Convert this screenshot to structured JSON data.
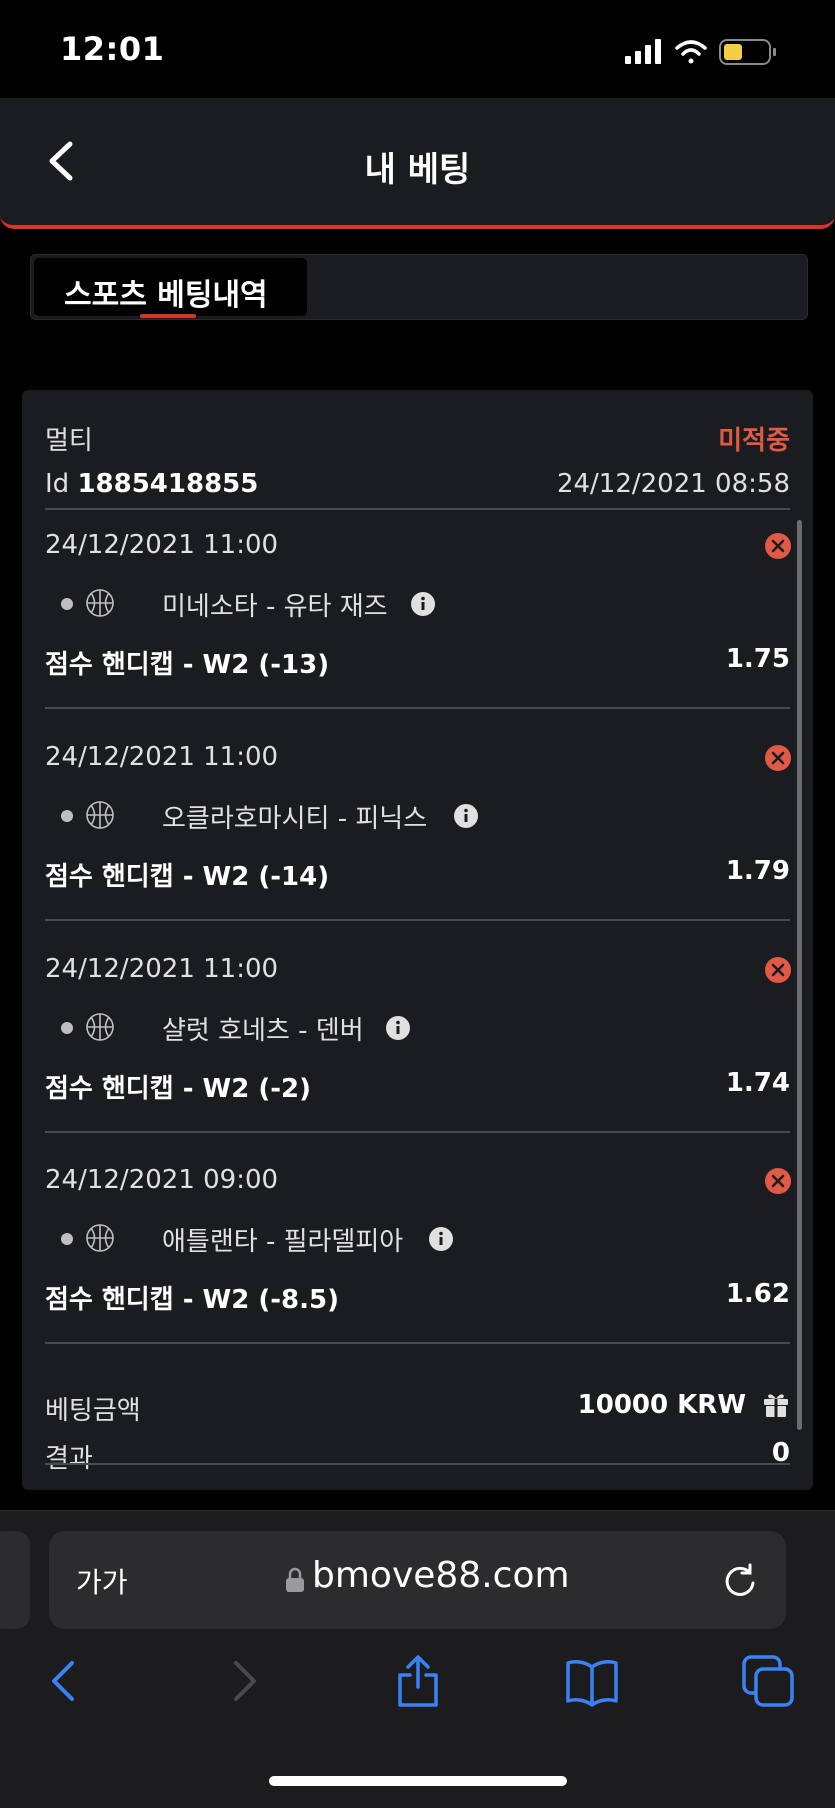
{
  "status_bar": {
    "time": "12:01"
  },
  "header": {
    "title": "내 베팅"
  },
  "tabs": [
    {
      "label": "스포츠 베팅내역",
      "active": true
    }
  ],
  "bet": {
    "type": "멀티",
    "status": "미적중",
    "id_label": "Id",
    "id_value": "1885418855",
    "placed_at": "24/12/2021 08:58",
    "selections": [
      {
        "date": "24/12/2021 11:00",
        "teams": "미네소타 - 유타 재즈",
        "market": "점수 핸디캡 - W2 (-13)",
        "odds": "1.75"
      },
      {
        "date": "24/12/2021 11:00",
        "teams": "오클라호마시티 - 피닉스",
        "market": "점수 핸디캡 - W2 (-14)",
        "odds": "1.79"
      },
      {
        "date": "24/12/2021 11:00",
        "teams": "샬럿 호네츠 - 덴버",
        "market": "점수 핸디캡 - W2 (-2)",
        "odds": "1.74"
      },
      {
        "date": "24/12/2021 09:00",
        "teams": "애틀랜타 - 필라델피아",
        "market": "점수 핸디캡 - W2 (-8.5)",
        "odds": "1.62"
      }
    ],
    "stake_label": "베팅금액",
    "stake_value": "10000 KRW",
    "result_label": "결과",
    "result_value": "0"
  },
  "browser": {
    "reader_label": "가가",
    "url": "bmove88.com"
  },
  "colors": {
    "accent": "#d8342a",
    "status_lost": "#e15a45",
    "card_bg": "#1b1c20",
    "safari_blue": "#3b82f6"
  },
  "icons": {
    "back": "chevron-left-icon",
    "cancel": "x-circle-icon",
    "sport": "basketball-icon",
    "info": "info-icon",
    "gift": "gift-icon",
    "lock": "lock-icon",
    "reload": "reload-icon",
    "share": "share-icon",
    "bookmarks": "book-icon",
    "tabs": "tabs-icon"
  }
}
